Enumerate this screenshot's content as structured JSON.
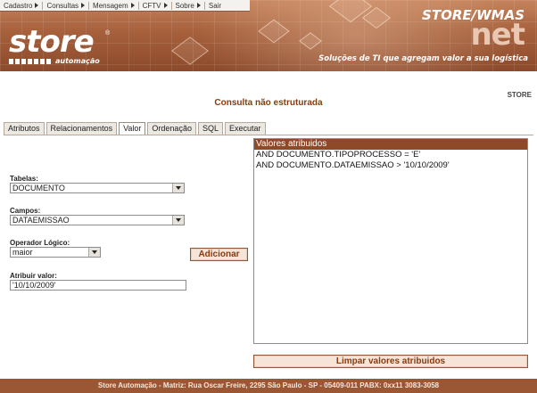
{
  "menu": {
    "items": [
      {
        "label": "Cadastro",
        "has_arrow": true
      },
      {
        "label": "Consultas",
        "has_arrow": true
      },
      {
        "label": "Mensagem",
        "has_arrow": true
      },
      {
        "label": "CFTV",
        "has_arrow": true
      },
      {
        "label": "Sobre",
        "has_arrow": true
      },
      {
        "label": "Sair",
        "has_arrow": false
      }
    ]
  },
  "header": {
    "logo_text": "store",
    "logo_subtext": "automação",
    "brand_top": "STORE/WMAS",
    "brand_bottom": "net",
    "tagline": "Soluções de TI que agregam valor a sua logística"
  },
  "page": {
    "title": "Consulta não estruturada",
    "user": "STORE"
  },
  "tabs": [
    {
      "label": "Atributos",
      "active": false
    },
    {
      "label": "Relacionamentos",
      "active": false
    },
    {
      "label": "Valor",
      "active": true
    },
    {
      "label": "Ordenação",
      "active": false
    },
    {
      "label": "SQL",
      "active": false
    },
    {
      "label": "Executar",
      "active": false
    }
  ],
  "form": {
    "tabelas": {
      "label": "Tabelas:",
      "value": "DOCUMENTO"
    },
    "campos": {
      "label": "Campos:",
      "value": "DATAEMISSAO"
    },
    "operador": {
      "label": "Operador Lógico:",
      "value": "maior"
    },
    "atribuir": {
      "label": "Atribuir valor:",
      "value": "'10/10/2009'"
    },
    "add_button": "Adicionar"
  },
  "values_list": {
    "header": "Valores atribuidos",
    "rows": [
      "AND DOCUMENTO.TIPOPROCESSO = 'E'",
      "AND DOCUMENTO.DATAEMISSAO > '10/10/2009'"
    ]
  },
  "clear_button": "Limpar valores atribuidos",
  "footer": "Store Automação - Matriz: Rua Oscar Freire, 2295 São Paulo - SP - 05409-011 PABX: 0xx11 3083-3058",
  "colors": {
    "brand": "#a6603c",
    "accent_text": "#8a3a0e",
    "list_header": "#8e4a28",
    "footer_bg": "#9b5733"
  }
}
